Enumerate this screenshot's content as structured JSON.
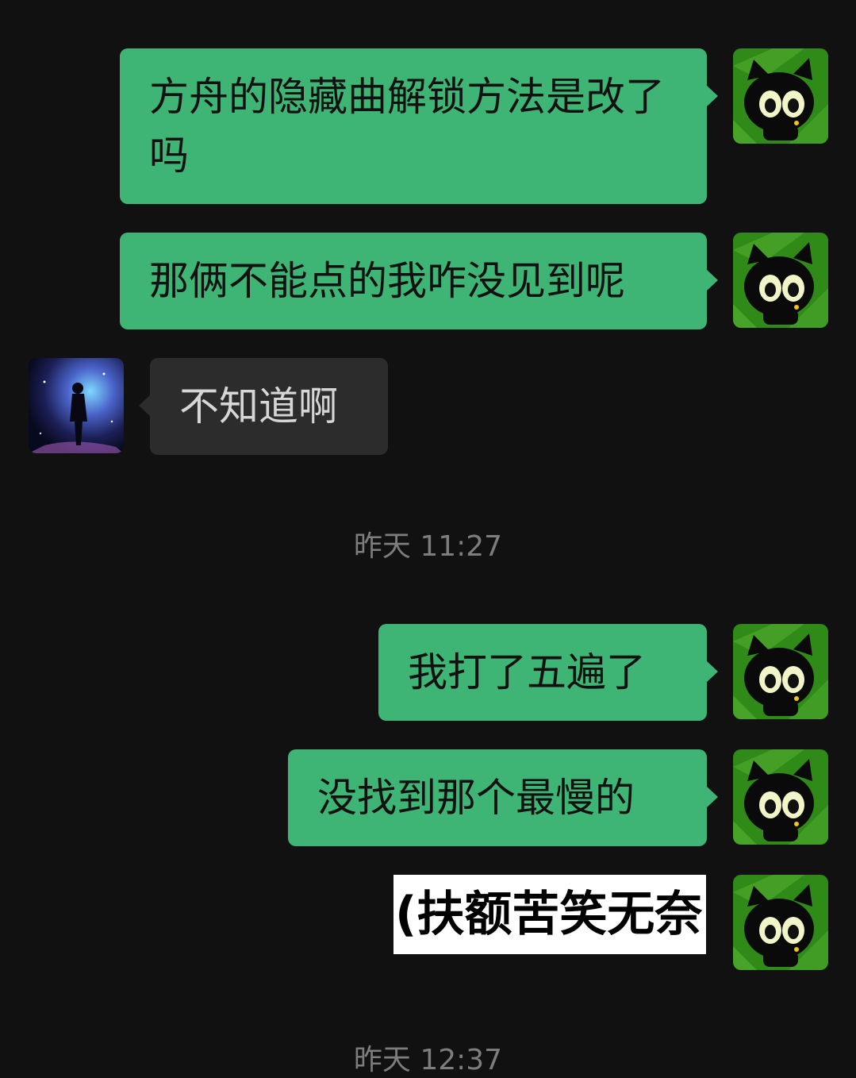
{
  "messages": [
    {
      "sender": "self",
      "text": "方舟的隐藏曲解锁方法是改了吗"
    },
    {
      "sender": "self",
      "text": "那俩不能点的我咋没见到呢"
    },
    {
      "sender": "other",
      "text": "不知道啊"
    },
    {
      "sender": "self",
      "text": "我打了五遍了"
    },
    {
      "sender": "self",
      "text": "没找到那个最慢的"
    },
    {
      "sender": "self",
      "text": "(扶额苦笑无奈",
      "kind": "sticker"
    }
  ],
  "timestamps": [
    "昨天 11:27",
    "昨天 12:37"
  ],
  "colors": {
    "background": "#111111",
    "self_bubble": "#3eb575",
    "other_bubble": "#2c2c2c",
    "timestamp_text": "#7d7d7d"
  },
  "avatars": {
    "self": "black-cat-avatar-icon",
    "other": "galaxy-silhouette-avatar-icon"
  }
}
